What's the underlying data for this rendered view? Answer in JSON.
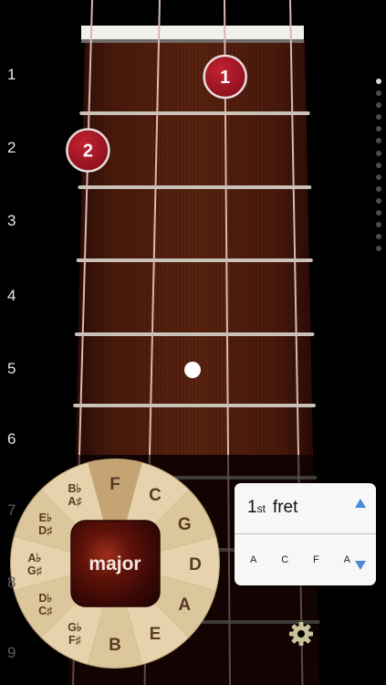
{
  "fret_numbers": [
    "1",
    "2",
    "3",
    "4",
    "5",
    "6",
    "7",
    "8",
    "9"
  ],
  "finger_markers": [
    {
      "finger": "1",
      "string": 3,
      "fret": 1
    },
    {
      "finger": "2",
      "string": 1,
      "fret": 2
    }
  ],
  "inlay_fret": 5,
  "strings": 4,
  "chord_wheel": {
    "quality_label": "major",
    "selected_key": "F",
    "keys": [
      "C",
      "G",
      "D",
      "A",
      "E",
      "B",
      "G♭ F♯",
      "D♭ C♯",
      "A♭ G♯",
      "E♭ D♯",
      "B♭ A♯",
      "F"
    ]
  },
  "fret_selector": {
    "ordinal": "1",
    "ordinal_suffix": "st",
    "word": "fret",
    "notes": [
      "A",
      "C",
      "F",
      "A"
    ]
  },
  "page_indicator": {
    "count": 15,
    "active_index": 0
  },
  "icons": {
    "settings": "gear-icon",
    "up": "triangle-up-icon",
    "down": "triangle-down-icon"
  },
  "colors": {
    "wood_dark": "#3b1109",
    "wood_light": "#5a2310",
    "marker_red": "#a01424",
    "string": "#d8b8b0",
    "fret_metal": "#c9c2b8",
    "accent_blue": "#4a88d8",
    "wheel_light": "#e4cfa6",
    "wheel_tan": "#c4a472",
    "tortoise_dark": "#3a0906",
    "tortoise_light": "#9e2f1c"
  }
}
